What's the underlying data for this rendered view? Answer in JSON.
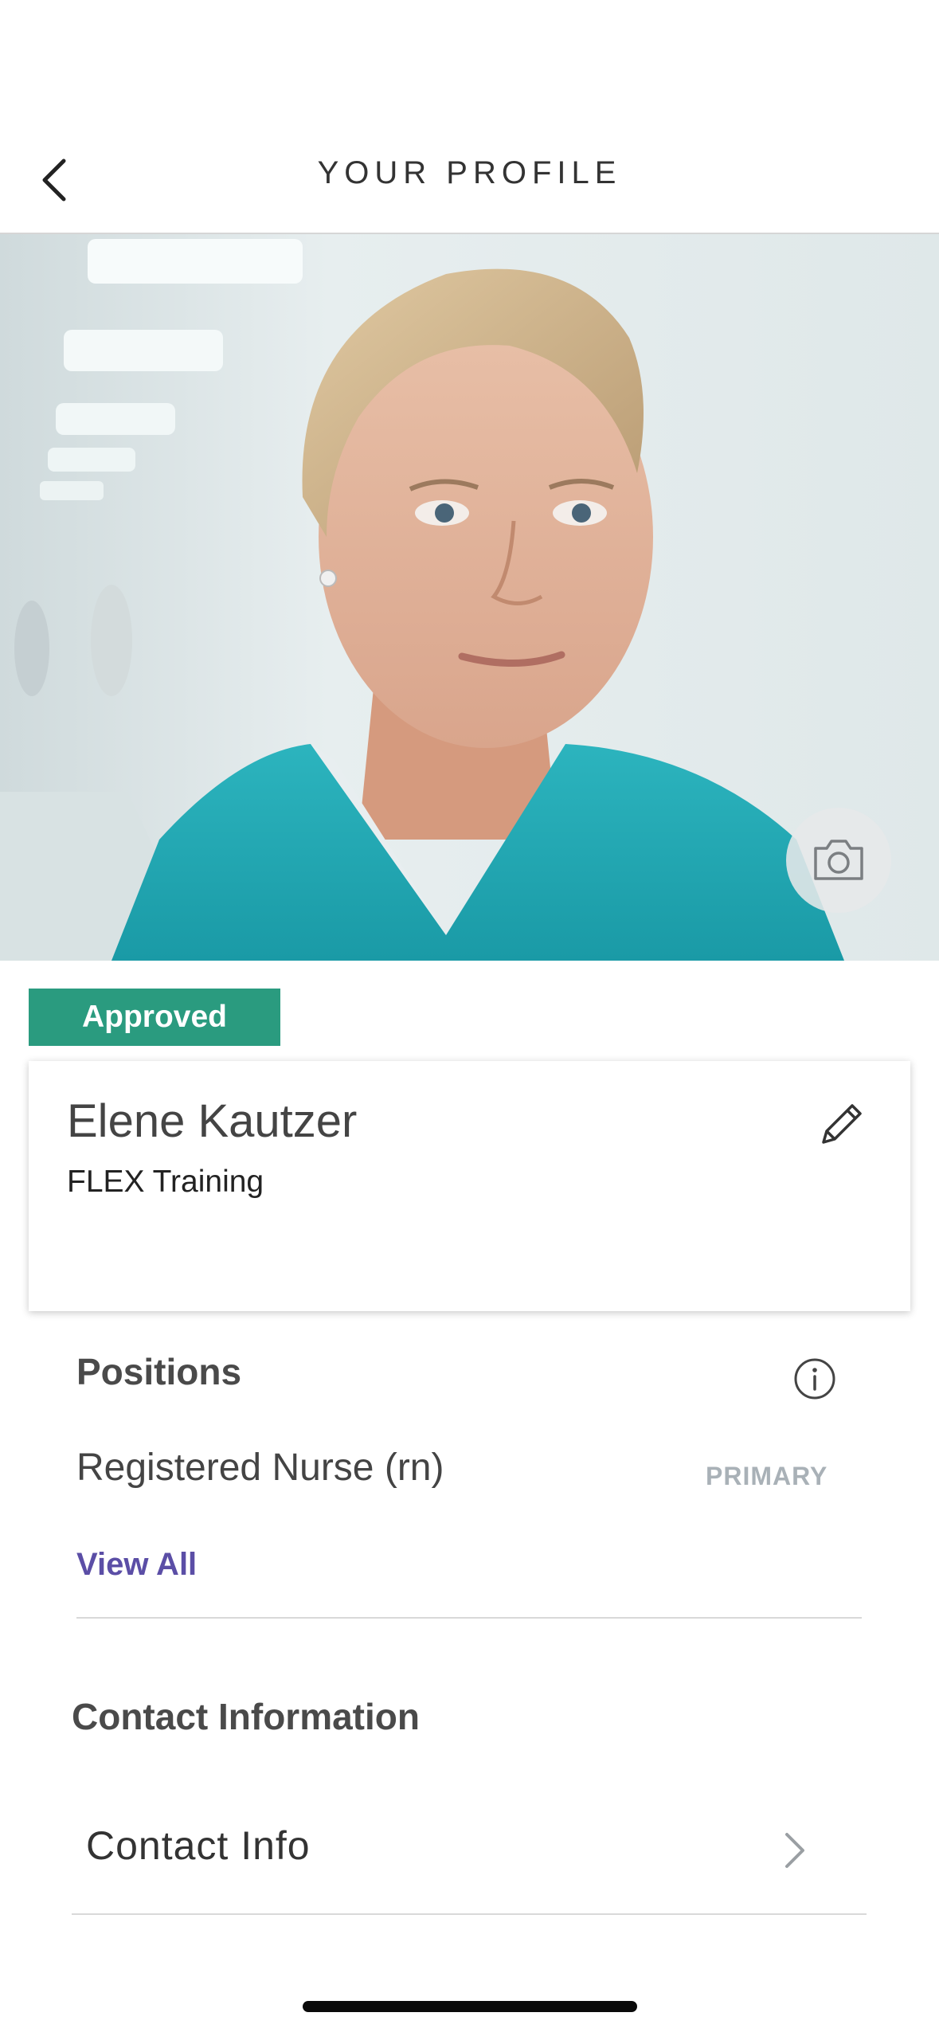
{
  "header": {
    "title": "YOUR PROFILE",
    "back_icon": "chevron-left-icon"
  },
  "hero": {
    "camera_icon": "camera-icon"
  },
  "profile": {
    "status_badge": "Approved",
    "status_color": "#2a9b7f",
    "name": "Elene Kautzer",
    "organization": "FLEX Training",
    "edit_icon": "pencil-icon"
  },
  "positions": {
    "title": "Positions",
    "info_icon": "info-icon",
    "items": [
      {
        "name": "Registered Nurse (rn)",
        "tag": "PRIMARY"
      }
    ],
    "view_all_label": "View All",
    "link_color": "#5b4ea6"
  },
  "contact": {
    "title": "Contact Information",
    "items": [
      {
        "label": "Contact Info",
        "icon": "chevron-right-icon"
      }
    ]
  }
}
